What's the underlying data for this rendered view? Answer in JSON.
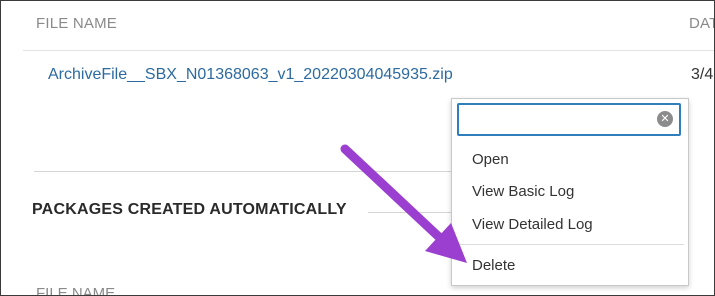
{
  "table": {
    "columns": [
      "FILE NAME",
      "DAT"
    ],
    "rows": [
      {
        "file_name": "ArchiveFile__SBX_N01368063_v1_20220304045935.zip",
        "date": "3/4"
      }
    ]
  },
  "section": {
    "title": "PACKAGES CREATED AUTOMATICALLY",
    "columns": [
      "FILE NAME"
    ]
  },
  "context_menu": {
    "search_value": "",
    "clear_icon": "clear-circle-icon",
    "items": [
      "Open",
      "View Basic Log",
      "View Detailed Log",
      "Delete"
    ]
  },
  "annotation": {
    "arrow_color": "#9a3fcf",
    "arrow_target": "Delete"
  }
}
